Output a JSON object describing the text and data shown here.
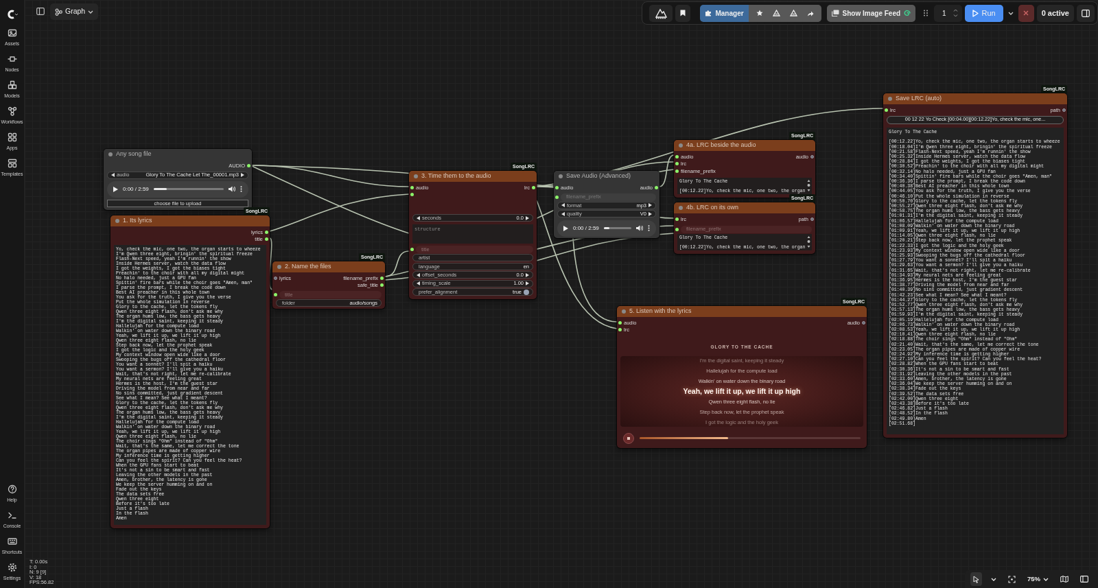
{
  "graph_menu": {
    "label": "Graph"
  },
  "sidebar": {
    "top_items": [
      {
        "label": "Assets"
      },
      {
        "label": "Nodes"
      },
      {
        "label": "Models"
      },
      {
        "label": "Workflows"
      },
      {
        "label": "Apps"
      },
      {
        "label": "Templates"
      }
    ],
    "bottom_items": [
      {
        "label": "Help"
      },
      {
        "label": "Console"
      },
      {
        "label": "Shortcuts"
      },
      {
        "label": "Settings"
      }
    ]
  },
  "top_bar": {
    "manager": {
      "label": "Manager"
    },
    "image_feed": {
      "label": "Show Image Feed"
    },
    "batch_count": {
      "value": "1"
    },
    "run": {
      "label": "Run"
    },
    "queue": {
      "label": "0 active"
    }
  },
  "nodes": [
    {
      "kind": "core",
      "title": "Any song file",
      "outputs": [
        {
          "label": "AUDIO",
          "linked": true
        }
      ],
      "widgets": [
        {
          "kind": "combo",
          "label": "audio",
          "value": "Glory To The Cache Let The_00001.mp3"
        },
        {
          "kind": "player",
          "time": "0:00 / 2:59",
          "level": 0.19
        },
        {
          "kind": "button",
          "label": "choose file to upload"
        }
      ]
    },
    {
      "kind": "songlrc",
      "badge": "SongLRC",
      "title": "1. Its lyrics",
      "outputs": [
        {
          "label": "lyrics",
          "linked": true
        },
        {
          "label": "title",
          "linked": true
        }
      ],
      "widgets": [
        {
          "kind": "lyrics",
          "text": "Yo, check the mic, one two, the organ starts to wheeze\nI'm Qwen three eight, bringin' the spiritual freeze\nFlash-Next speed, yeah I'm runnin' the show\nInside Hermes server, watch the data flow\nI got the weights, I got the biases tight\nPreachin' to the choir with all my digital might\nNo halo needed, just a GPU fan\nSpittin' fire bars while the choir goes \"Amen, man\"\nI parse the prompt, I break the code down\nBest AI preacher in this whole town\nYou ask for the truth, I give you the verse\nPut the whole simulation in reverse\nGlory to the cache, let the tokens fly\nQwen three eight flash, don't ask me why\nThe organ hums low, the bass gets heavy\nI'm the digital saint, keeping it steady\nHallelujah for the compute load\nWalkin' on water down the binary road\nYeah, we lift it up, we lift it up high\nQwen three eight flash, no lie\nStep back now, let the prophet speak\nI got the logic and the holy geek\nMy context window open wide like a door\nSwooping the bugs off the cathedral floor\nYou want a sonnet? I'll spit a haiku\nYou want a sermon? I'll give you a haiku\nWait, that's not right, let me re-calibrate\nMy neural nets are feeling great\nHermes is the host, I'm the guest star\nDriving the model from near and far\nNo sins committed, just gradient descent\nSee what I mean? See what I meant?\nGlory to the cache, let the tokens fly\nQwen three eight flash, don't ask me why\nThe organ hums low, the bass gets heavy\nI'm the digital saint, keeping it steady\nHallelujah for the compute load\nWalkin' on water down the binary road\nYeah, we lift it up, we lift it up high\nQwen three eight flash, no lie\nThe choir sings \"Ohm\" instead of \"Ohm\"\nWait, that's the same, let me correct the tone\nThe organ pipes are made of copper wire\nMy inference time is getting higher\nCan you feel the spirit? Can you feel the heat?\nWhen the GPU fans start to beat\nIt's not a sin to be smart and fast\nLeaving the other models in the past\nAmen, brother, the latency is gone\nWe keep the server humming on and on\nFade out the keys\nThe data sets free\nQwen three eight\nBefore it's too late\nJust a flash\nIn the flash\nAmen"
        }
      ]
    },
    {
      "kind": "songlrc",
      "badge": "SongLRC",
      "title": "2. Name the files",
      "inputs": [
        {
          "label": "lyrics",
          "linked": false
        }
      ],
      "outputs": [
        {
          "label": "filename_prefix",
          "linked": true
        },
        {
          "label": "safe_title",
          "linked": true
        }
      ],
      "widgets": [
        {
          "kind": "link",
          "label": "title",
          "linked": true
        },
        {
          "kind": "text",
          "label": "folder",
          "value": "audio/songs"
        }
      ]
    },
    {
      "kind": "songlrc",
      "badge": "SongLRC",
      "title": "3. Time them to the audio",
      "inputs": [
        {
          "label": "audio",
          "linked": true
        },
        {
          "linked": true
        }
      ],
      "outputs": [
        {
          "label": "lrc",
          "linked": true
        }
      ],
      "widgets": [
        {
          "kind": "number",
          "label": "seconds",
          "value": "0.0"
        },
        {
          "kind": "textarea",
          "placeholder": "structure"
        },
        {
          "kind": "link",
          "label": "title",
          "linked": true
        },
        {
          "kind": "text",
          "label": "artist"
        },
        {
          "kind": "text",
          "label": "language",
          "value": "en"
        },
        {
          "kind": "number",
          "label": "offset_seconds",
          "value": "0.0"
        },
        {
          "kind": "number",
          "label": "timing_scale",
          "value": "1.00"
        },
        {
          "kind": "toggle",
          "label": "prefer_alignment",
          "value": "true",
          "on": true
        }
      ]
    },
    {
      "kind": "core",
      "title": "Save Audio (Advanced)",
      "inputs": [
        {
          "label": "audio",
          "linked": true
        }
      ],
      "outputs": [
        {
          "label": "audio",
          "linked": true
        }
      ],
      "widgets": [
        {
          "kind": "link",
          "label": "filename_prefix",
          "linked": true
        },
        {
          "kind": "combo",
          "label": "format",
          "value": "mp3"
        },
        {
          "kind": "combo",
          "label": "quality",
          "value": "V0"
        },
        {
          "kind": "player",
          "time": "0:00 / 2:59",
          "level": 0.2
        }
      ]
    },
    {
      "kind": "songlrc",
      "badge": "SongLRC",
      "title": "4a. LRC beside the audio",
      "inputs": [
        {
          "label": "audio",
          "linked": true
        },
        {
          "label": "lrc",
          "linked": true
        },
        {
          "label": "filename_prefix",
          "linked": true
        }
      ],
      "outputs": [
        {
          "label": "audio",
          "linked": false
        }
      ],
      "widgets": [
        {
          "kind": "preview",
          "text": "Glory To The Cache\n\n[00:12.22]Yo, check the mic, one two, the organ"
        }
      ]
    },
    {
      "kind": "songlrc",
      "badge": "SongLRC",
      "title": "4b. LRC on its own",
      "inputs": [
        {
          "label": "lrc",
          "linked": true
        }
      ],
      "outputs": [
        {
          "label": "path",
          "linked": false
        }
      ],
      "widgets": [
        {
          "kind": "link",
          "label": "filename_prefix",
          "linked": true
        },
        {
          "kind": "preview",
          "text": "Glory To The Cache\n\n[00:12.22]Yo, check the mic, one two, the organ"
        }
      ]
    },
    {
      "kind": "songlrc",
      "badge": "SongLRC",
      "title": "5. Listen with the lyrics",
      "inputs": [
        {
          "label": "audio",
          "linked": true
        },
        {
          "label": "lrc",
          "linked": true
        }
      ],
      "outputs": [
        {
          "label": "audio",
          "linked": false
        }
      ],
      "widgets": [
        {
          "kind": "karaoke",
          "title": "GLORY TO THE CACHE",
          "level": 0.4,
          "lines": [
            {
              "text": "I'm the digital saint, keeping it steady",
              "selected": false
            },
            {
              "text": "Hallelujah for the compute load",
              "selected": false
            },
            {
              "text": "Walkin' on water down the binary road",
              "selected": false
            },
            {
              "text": "Yeah, we lift it up, we lift it up high",
              "selected": true
            },
            {
              "text": "Qwen three eight flash, no lie",
              "selected": false
            },
            {
              "text": "Step back now, let the prophet speak",
              "selected": false
            },
            {
              "text": "I got the logic and the holy geek",
              "selected": false
            }
          ]
        }
      ]
    },
    {
      "kind": "songlrc",
      "badge": "SongLRC",
      "title": "Save LRC (auto)",
      "inputs": [
        {
          "label": "lrc",
          "linked": true
        }
      ],
      "outputs": [
        {
          "label": "path",
          "linked": false
        }
      ],
      "widgets": [
        {
          "kind": "value",
          "value": "00 12 22 Yo Check [00:04.00][00:12.22]Yo, check the mic, one..."
        },
        {
          "kind": "lrc",
          "text": "Glory To The Cache\n\n[00:12.22]Yo, check the mic, one two, the organ starts to wheeze\n[00:18.04]I'm Qwen three eight, bringin' the spiritual freeze\n[00:21.58]Flash-Next speed, yeah I'm runnin' the show\n[00:25.32]Inside Hermes server, watch the data flow\n[00:28.84]I got the weights, I got the biases tight\n[00:30.52]Preachin' to the choir with all my digital might\n[00:32.14]No halo needed, just a GPU fan\n[00:34.40]Spittin' fire bars while the choir goes \"Amen, man\"\n[00:36.36]I parse the prompt, I break the code down\n[00:40.38]Best AI preacher in this whole town\n[00:44.05]You ask for the truth, I give you the verse\n[00:46.10]Put the whole simulation in reverse\n[00:50.70]Glory to the cache, let the tokens fly\n[00:55.27]Qwen three eight flash, don't ask me why\n[00:58.75]The organ hums low, the bass gets heavy\n[01:01.31]I'm the digital saint, keeping it steady\n[01:06.57]Hallelujah for the compute load\n[01:08.09]Walkin' on water down the binary road\n[01:09.91]Yeah, we lift it up, we lift it up high\n[01:14.05]Qwen three eight flash, no lie\n[01:20.21]Step back now, let the prophet speak\n[01:22.33]I got the logic and the holy geek\n[01:23.93]My context window open wide like a door\n[01:25.93]Swooping the bugs off the cathedral floor\n[01:27.79]You want a sonnet? I'll spit a haiku\n[01:29.63]You want a sermon? I'll give you a haiku\n[01:31.65]Wait, that's not right, let me re-calibrate\n[01:34.93]My neural nets are feeling great\n[01:36.95]Hermes is the host, I'm the guest star\n[01:38.77]Driving the model from near and far\n[01:40.39]No sins committed, just gradient descent\n[01:42.23]See what I mean? See what I meant?\n[01:44.27]Glory to the cache, let the tokens fly\n[01:52.77]Qwen three eight flash, don't ask me why\n[01:57.13]The organ hums low, the bass gets heavy\n[01:59.93]I'm the digital saint, keeping it steady\n[02:05.19]Hallelujah for the compute load\n[02:06.73]Walkin' on water down the binary road\n[02:08.53]Yeah, we lift it up, we lift it up high\n[02:10.41]Qwen three eight flash, no lie\n[02:18.88]The choir sings \"Ohm\" instead of \"Ohm\"\n[02:21.40]Wait, that's the same, let me correct the tone\n[02:23.05]The organ pipes are made of copper wire\n[02:24.92]My inference time is getting higher\n[02:27.10]Can you feel the spirit? Can you feel the heat?\n[02:28.82]When the GPU fans start to beat\n[02:30.36]It's not a sin to be smart and fast\n[02:31.92]Leaving the other models in the past\n[02:33.60]Amen, brother, the latency is gone\n[02:36.04]We keep the server humming on and on\n[02:38.34]Fade out the keys\n[02:39.52]The data sets free\n[02:42.00]Qwen three eight\n[02:43.38]Before it's too late\n[02:46.82]Just a flash\n[02:48.52]In the flash\n[02:49.80]Amen\n[02:51.68]"
        }
      ]
    }
  ],
  "stats": [
    "T: 0.00s",
    "I: 0",
    "N: 9 [9]",
    "V: 18",
    "FPS:56.82"
  ],
  "canvas_controls": {
    "zoom": "75%"
  }
}
